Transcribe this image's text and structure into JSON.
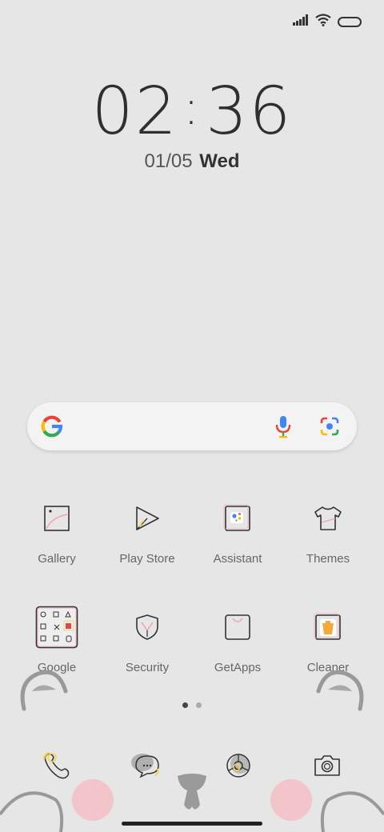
{
  "status": {
    "signal": "signal-icon",
    "wifi": "wifi-icon",
    "battery": "battery-icon"
  },
  "clock": {
    "hours": "02",
    "minutes": "36",
    "date": "01/05",
    "weekday": "Wed"
  },
  "search": {
    "logo": "google-g-icon",
    "mic": "mic-icon",
    "lens": "lens-icon"
  },
  "apps_row1": [
    {
      "label": "Gallery",
      "icon": "gallery-icon"
    },
    {
      "label": "Play Store",
      "icon": "play-store-icon"
    },
    {
      "label": "Assistant",
      "icon": "assistant-icon"
    },
    {
      "label": "Themes",
      "icon": "themes-icon"
    }
  ],
  "apps_row2": [
    {
      "label": "Google",
      "icon": "google-folder-icon"
    },
    {
      "label": "Security",
      "icon": "security-icon"
    },
    {
      "label": "GetApps",
      "icon": "getapps-icon"
    },
    {
      "label": "Cleaner",
      "icon": "cleaner-icon"
    }
  ],
  "pager": {
    "pages": 2,
    "current": 1
  },
  "dock": [
    {
      "icon": "phone-icon"
    },
    {
      "icon": "messages-icon"
    },
    {
      "icon": "browser-icon"
    },
    {
      "icon": "camera-icon"
    }
  ],
  "colors": {
    "background": "#e6e6e6",
    "accent_pink": "#f0c7cc",
    "accent_yellow": "#f3d54a"
  }
}
